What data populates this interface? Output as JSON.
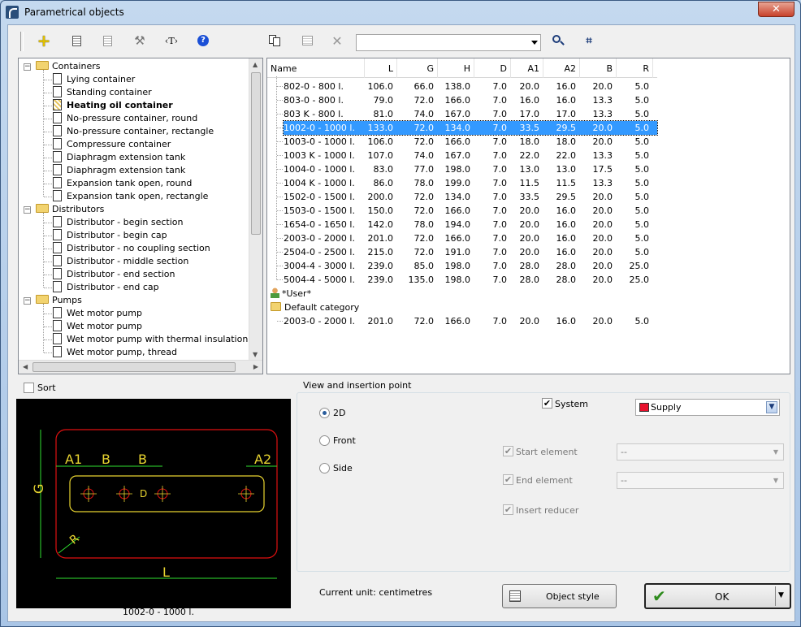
{
  "window": {
    "title": "Parametrical objects",
    "close_label": "✕"
  },
  "toolbar": {
    "add_icon": "+",
    "t_label": "‹T›",
    "help_label": "?",
    "combo_value": ""
  },
  "tree": {
    "categories": [
      {
        "label": "Containers",
        "items": [
          "Lying container",
          "Standing container",
          "Heating oil container",
          "No-pressure container, round",
          "No-pressure container, rectangle",
          "Compressure container",
          "Diaphragm extension tank",
          "Diaphragm extension tank",
          "Expansion tank open, round",
          "Expansion tank open, rectangle"
        ]
      },
      {
        "label": "Distributors",
        "items": [
          "Distributor - begin section",
          "Distributor - begin cap",
          "Distributor - no coupling section",
          "Distributor - middle section",
          "Distributor - end section",
          "Distributor - end cap"
        ]
      },
      {
        "label": "Pumps",
        "items": [
          "Wet motor pump",
          "Wet motor pump",
          "Wet motor pump with thermal insulation",
          "Wet motor pump, thread"
        ]
      }
    ],
    "selected": "Heating oil container"
  },
  "grid": {
    "columns": [
      "Name",
      "L",
      "G",
      "H",
      "D",
      "A1",
      "A2",
      "B",
      "R"
    ],
    "rows": [
      [
        "802-0 - 800 l.",
        "106.0",
        "66.0",
        "138.0",
        "7.0",
        "20.0",
        "16.0",
        "20.0",
        "5.0"
      ],
      [
        "803-0 - 800 l.",
        "79.0",
        "72.0",
        "166.0",
        "7.0",
        "16.0",
        "16.0",
        "13.3",
        "5.0"
      ],
      [
        "803 K - 800 l.",
        "81.0",
        "74.0",
        "167.0",
        "7.0",
        "17.0",
        "17.0",
        "13.3",
        "5.0"
      ],
      [
        "1002-0 - 1000 l.",
        "133.0",
        "72.0",
        "134.0",
        "7.0",
        "33.5",
        "29.5",
        "20.0",
        "5.0"
      ],
      [
        "1003-0 - 1000 l.",
        "106.0",
        "72.0",
        "166.0",
        "7.0",
        "18.0",
        "18.0",
        "20.0",
        "5.0"
      ],
      [
        "1003 K - 1000 l.",
        "107.0",
        "74.0",
        "167.0",
        "7.0",
        "22.0",
        "22.0",
        "13.3",
        "5.0"
      ],
      [
        "1004-0 - 1000 l.",
        "83.0",
        "77.0",
        "198.0",
        "7.0",
        "13.0",
        "13.0",
        "17.5",
        "5.0"
      ],
      [
        "1004 K - 1000 l.",
        "86.0",
        "78.0",
        "199.0",
        "7.0",
        "11.5",
        "11.5",
        "13.3",
        "5.0"
      ],
      [
        "1502-0 - 1500 l.",
        "200.0",
        "72.0",
        "134.0",
        "7.0",
        "33.5",
        "29.5",
        "20.0",
        "5.0"
      ],
      [
        "1503-0 - 1500 l.",
        "150.0",
        "72.0",
        "166.0",
        "7.0",
        "20.0",
        "16.0",
        "20.0",
        "5.0"
      ],
      [
        "1654-0 - 1650 l.",
        "142.0",
        "78.0",
        "194.0",
        "7.0",
        "20.0",
        "16.0",
        "20.0",
        "5.0"
      ],
      [
        "2003-0 - 2000 l.",
        "201.0",
        "72.0",
        "166.0",
        "7.0",
        "20.0",
        "16.0",
        "20.0",
        "5.0"
      ],
      [
        "2504-0 - 2500 l.",
        "215.0",
        "72.0",
        "191.0",
        "7.0",
        "20.0",
        "16.0",
        "20.0",
        "5.0"
      ],
      [
        "3004-4 - 3000 l.",
        "239.0",
        "85.0",
        "198.0",
        "7.0",
        "28.0",
        "28.0",
        "20.0",
        "25.0"
      ],
      [
        "5004-4 - 5000 l.",
        "239.0",
        "135.0",
        "198.0",
        "7.0",
        "28.0",
        "28.0",
        "20.0",
        "25.0"
      ]
    ],
    "selected_row": "1002-0 - 1000 l.",
    "user_category": "*User*",
    "default_category": "Default category",
    "default_rows": [
      [
        "2003-0 - 2000 l.",
        "201.0",
        "72.0",
        "166.0",
        "7.0",
        "20.0",
        "16.0",
        "20.0",
        "5.0"
      ]
    ]
  },
  "sort": {
    "label": "Sort",
    "checked": false
  },
  "preview": {
    "caption": "1002-0 - 1000 l.",
    "dims": {
      "a1": "A1",
      "b": "B",
      "a2": "A2",
      "g": "G",
      "r": "R",
      "l": "L"
    }
  },
  "view": {
    "group_title": "View and insertion point",
    "options": [
      "2D",
      "Front",
      "Side"
    ],
    "selected": "2D"
  },
  "system": {
    "label": "System",
    "checked": true,
    "value": "Supply",
    "color": "#e8112d"
  },
  "start_element": {
    "label": "Start element",
    "value": "--",
    "checked": true
  },
  "end_element": {
    "label": "End element",
    "value": "--",
    "checked": true
  },
  "insert_reducer": {
    "label": "Insert reducer",
    "checked": true
  },
  "unit_text": "Current unit: centimetres",
  "buttons": {
    "object_style": "Object style",
    "ok": "OK"
  }
}
